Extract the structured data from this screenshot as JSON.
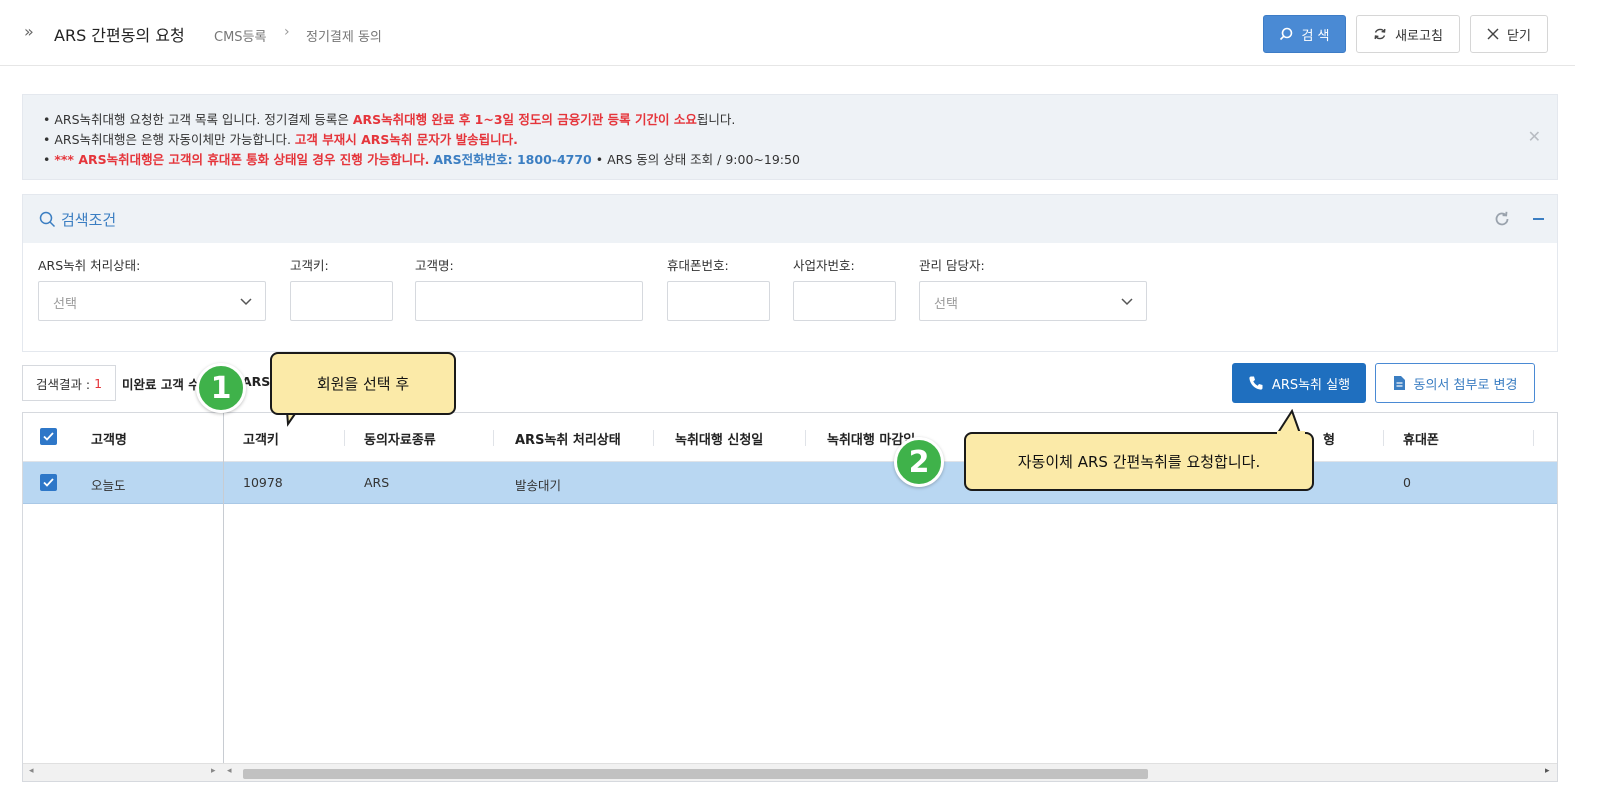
{
  "header": {
    "title": "ARS 간편동의 요청",
    "breadcrumb": [
      "CMS등록",
      "정기결제 동의"
    ],
    "search_label": "검 색",
    "refresh_label": "새로고침",
    "close_label": "닫기"
  },
  "notice": {
    "line1_a": "ARS녹취대행 요청한 고객 목록 입니다. 정기결제 등록은 ",
    "line1_b": "ARS녹취대행 완료 후 1~3일 정도의 금융기관 등록 기간이 소요",
    "line1_c": "됩니다.",
    "line2_a": "ARS녹취대행은 은행 자동이체만 가능합니다. ",
    "line2_b": "고객 부재시 ARS녹취 문자가 발송됩니다.",
    "line3_a": "*** ARS녹취대행은 고객의 휴대폰 통화 상태일 경우 진행 가능합니다.",
    "line3_b": "ARS전화번호: 1800-4770",
    "line3_c": " ARS 동의 상태 조회 / 9:00~19:50",
    "close": "✕"
  },
  "search": {
    "title": "검색조건",
    "fields": [
      {
        "label": "ARS녹취 처리상태:",
        "placeholder": "선택"
      },
      {
        "label": "고객키:",
        "value": ""
      },
      {
        "label": "고객명:",
        "value": ""
      },
      {
        "label": "휴대폰번호:",
        "value": ""
      },
      {
        "label": "사업자번호:",
        "value": ""
      },
      {
        "label": "관리 담당자:",
        "placeholder": "선택"
      }
    ]
  },
  "results": {
    "label": "검색결과 : ",
    "count": "1",
    "incomplete_text": "미완료 고객 수",
    "ars_text": "ARS",
    "ars_run_label": "ARS녹취 실행",
    "attach_label": "동의서 첨부로 변경"
  },
  "table": {
    "columns": [
      "고객명",
      "고객키",
      "동의자료종류",
      "ARS녹취 처리상태",
      "녹취대행 신청일",
      "녹취대행 마감일",
      "형",
      "휴대폰"
    ],
    "rows": [
      {
        "name": "오늘도",
        "key": "10978",
        "type": "ARS",
        "status": "발송대기",
        "phone": "0"
      }
    ]
  },
  "callouts": {
    "badge1": "1",
    "badge2": "2",
    "text1": "회원을 선택 후",
    "text2": "자동이체 ARS 간편녹취를 요청합니다."
  },
  "colors": {
    "primary": "#4a8ad4",
    "ars_button": "#1f6fbf",
    "selected_row": "#b9d7f2",
    "callout_bg": "#fbeaa8",
    "badge": "#3fb24a",
    "alert_red": "#e5353b"
  }
}
